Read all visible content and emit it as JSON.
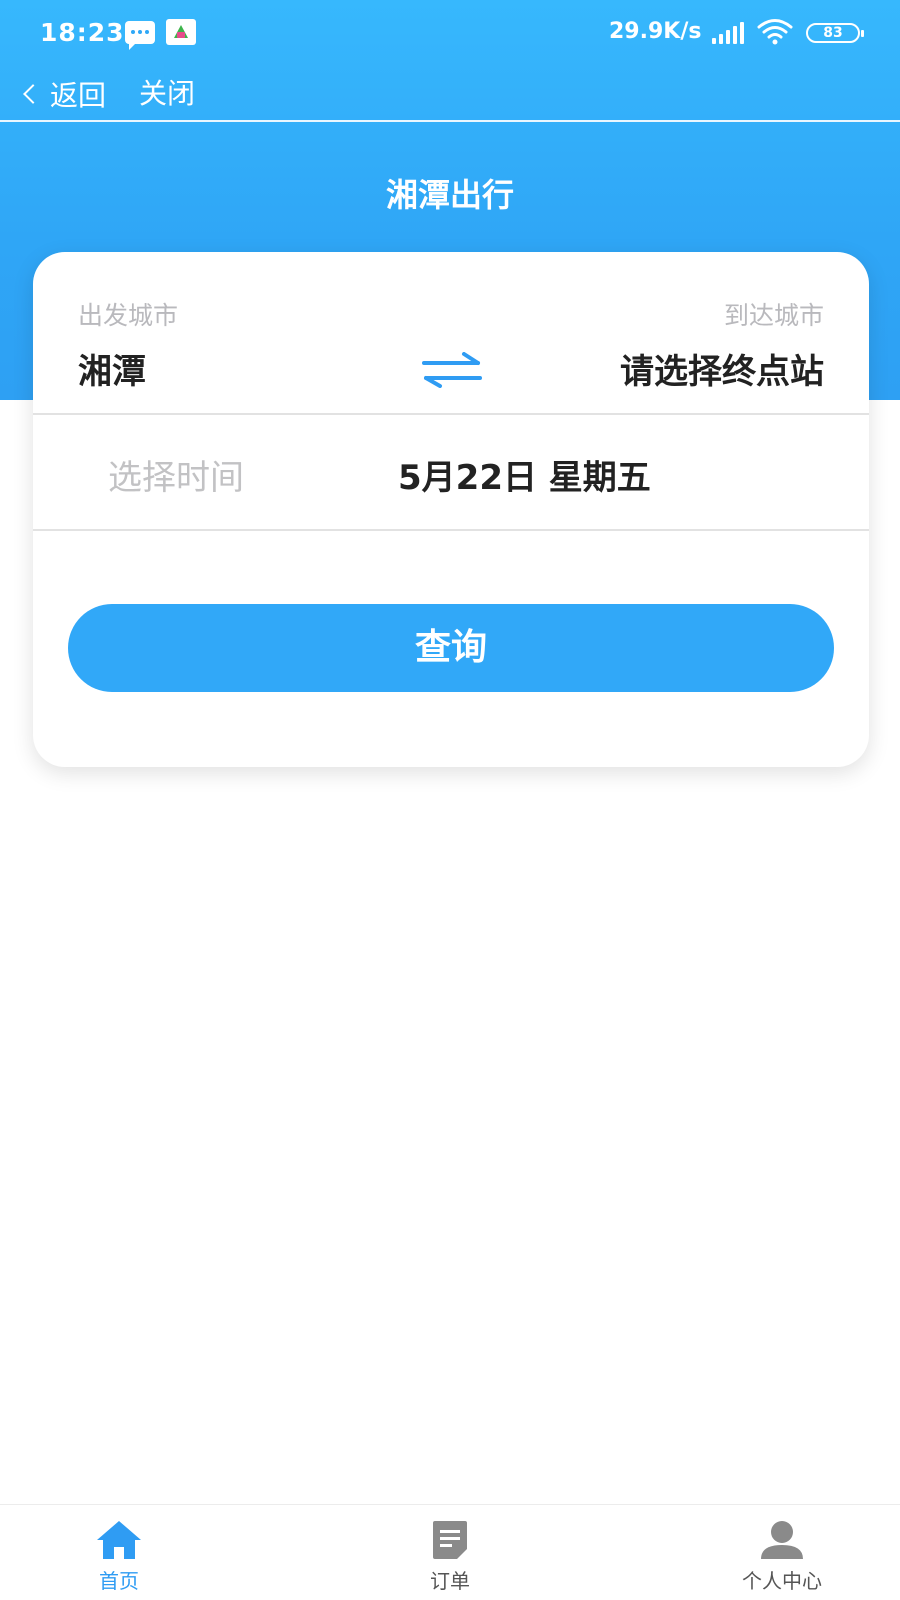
{
  "status_bar": {
    "time": "18:23",
    "speed": "29.9K/s",
    "battery": "83"
  },
  "nav": {
    "back_label": "返回",
    "close_label": "关闭"
  },
  "page": {
    "title": "湘潭出行"
  },
  "form": {
    "from_label": "出发城市",
    "to_label": "到达城市",
    "from_city": "湘潭",
    "to_city": "请选择终点站",
    "time_label": "选择时间",
    "time_value": "5月22日 星期五",
    "query_label": "查询"
  },
  "tabs": [
    {
      "label": "首页",
      "icon": "home-icon",
      "active": true
    },
    {
      "label": "订单",
      "icon": "orders-icon",
      "active": false
    },
    {
      "label": "个人中心",
      "icon": "user-icon",
      "active": false
    }
  ],
  "colors": {
    "primary": "#31a8f8",
    "header": "#37b8fd",
    "tab_active": "#2f9cf3",
    "tab_inactive": "#555555"
  }
}
